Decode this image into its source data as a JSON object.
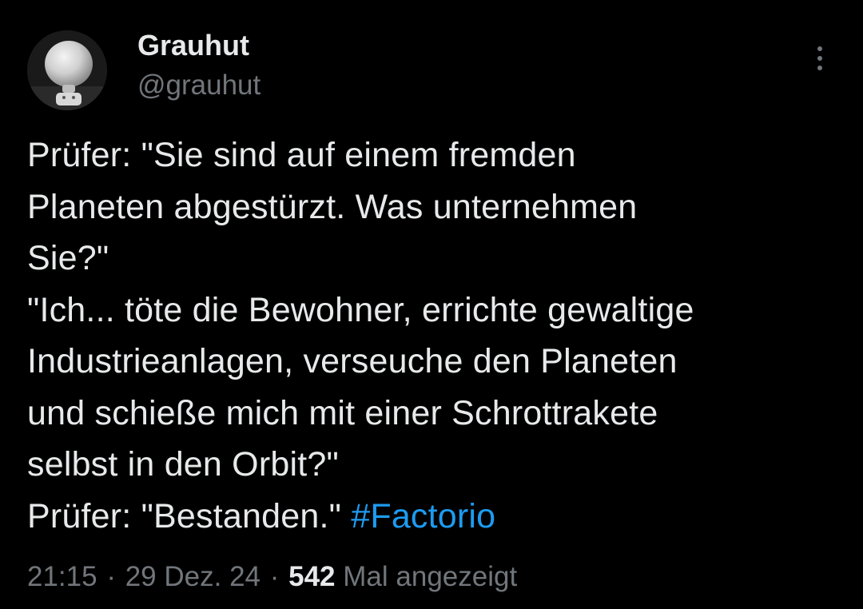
{
  "author": {
    "display_name": "Grauhut",
    "handle": "@grauhut"
  },
  "tweet": {
    "lines": [
      "Prüfer: \"Sie sind auf einem fremden",
      "Planeten abgestürzt. Was unternehmen",
      "Sie?\"",
      "\"Ich... töte die Bewohner, errichte gewaltige",
      "Industrieanlagen, verseuche den Planeten",
      "und schieße mich mit einer Schrottrakete",
      "selbst in den Orbit?\""
    ],
    "last_line_text": "Prüfer: \"Bestanden.\" ",
    "hashtag": "#Factorio"
  },
  "meta": {
    "time": "21:15",
    "separator": "·",
    "date": "29 Dez. 24",
    "views_count": "542",
    "views_label": "Mal angezeigt"
  },
  "colors": {
    "background": "#000000",
    "text": "#e7e9ea",
    "secondary": "#71767b",
    "accent": "#1d9bf0"
  },
  "icons": {
    "more": "more-vertical-icon"
  }
}
